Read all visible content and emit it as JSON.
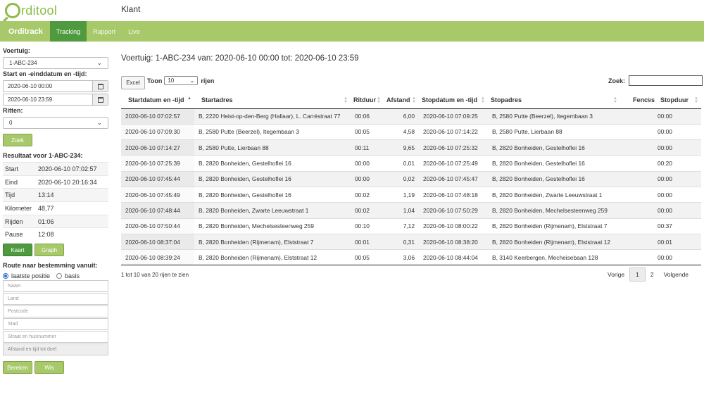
{
  "app": {
    "logo_text": "rditool",
    "page_heading": "Klant"
  },
  "nav": {
    "brand": "Orditrack",
    "items": [
      "Tracking",
      "Rapport",
      "Live"
    ],
    "active": "Tracking"
  },
  "sidebar": {
    "vehicle_label": "Voertuig:",
    "vehicle_value": "1-ABC-234",
    "date_label": "Start en -einddatum en -tijd:",
    "start_value": "2020-06-10 00:00",
    "end_value": "2020-06-10 23:59",
    "trips_label": "Ritten:",
    "trips_value": "0",
    "search_button": "Zoek",
    "result_label": "Resultaat voor 1-ABC-234:",
    "results": [
      {
        "key": "Start",
        "value": "2020-06-10 07:02:57"
      },
      {
        "key": "Eind",
        "value": "2020-06-10 20:16:34"
      },
      {
        "key": "Tijd",
        "value": "13:14"
      },
      {
        "key": "Kilometer",
        "value": "48,77"
      },
      {
        "key": "Rijden",
        "value": "01:06"
      },
      {
        "key": "Pause",
        "value": "12:08"
      }
    ],
    "map_button": "Kaart",
    "graph_button": "Graph",
    "route_label": "Route naar bestemming vanuit:",
    "radio_last": "laatste positie",
    "radio_base": "basis",
    "placeholders": {
      "name": "Naam",
      "country": "Land",
      "postcode": "Postcode",
      "city": "Stad",
      "street": "Straat en huisnummer",
      "distance": "Afstand en tijd tot doel"
    },
    "calc_button": "Bereken",
    "clear_button": "Wis"
  },
  "main": {
    "title": "Voertuig: 1-ABC-234 van: 2020-06-10 00:00 tot: 2020-06-10 23:59",
    "excel_button": "Excel",
    "show_label": "Toon",
    "page_length": "10",
    "rows_label": "rijen",
    "search_label": "Zoek:",
    "columns": [
      "Startdatum en -tijd",
      "Startadres",
      "Ritduur",
      "Afstand",
      "Stopdatum en -tijd",
      "Stopadres",
      "Fences",
      "Stopduur"
    ],
    "rows": [
      [
        "2020-06-10 07:02:57",
        "B, 2220 Heist-op-den-Berg (Hallaar), L. Carréstraat 77",
        "00:06",
        "6,00",
        "2020-06-10 07:09:25",
        "B, 2580 Putte (Beerzel), Itegembaan 3",
        "",
        "00:00"
      ],
      [
        "2020-06-10 07:09:30",
        "B, 2580 Putte (Beerzel), Itegembaan 3",
        "00:05",
        "4,58",
        "2020-06-10 07:14:22",
        "B, 2580 Putte, Lierbaan 88",
        "",
        "00:00"
      ],
      [
        "2020-06-10 07:14:27",
        "B, 2580 Putte, Lierbaan 88",
        "00:11",
        "9,65",
        "2020-06-10 07:25:32",
        "B, 2820 Bonheiden, Gestelhoflei 16",
        "",
        "00:00"
      ],
      [
        "2020-06-10 07:25:39",
        "B, 2820 Bonheiden, Gestelhoflei 16",
        "00:00",
        "0,01",
        "2020-06-10 07:25:49",
        "B, 2820 Bonheiden, Gestelhoflei 16",
        "",
        "00:20"
      ],
      [
        "2020-06-10 07:45:44",
        "B, 2820 Bonheiden, Gestelhoflei 16",
        "00:00",
        "0,02",
        "2020-06-10 07:45:47",
        "B, 2820 Bonheiden, Gestelhoflei 16",
        "",
        "00:00"
      ],
      [
        "2020-06-10 07:45:49",
        "B, 2820 Bonheiden, Gestelhoflei 16",
        "00:02",
        "1,19",
        "2020-06-10 07:48:18",
        "B, 2820 Bonheiden, Zwarte Leeuwstraat 1",
        "",
        "00:00"
      ],
      [
        "2020-06-10 07:48:44",
        "B, 2820 Bonheiden, Zwarte Leeuwstraat 1",
        "00:02",
        "1,04",
        "2020-06-10 07:50:29",
        "B, 2820 Bonheiden, Mechelsesteenweg 259",
        "",
        "00:00"
      ],
      [
        "2020-06-10 07:50:44",
        "B, 2820 Bonheiden, Mechelsesteenweg 259",
        "00:10",
        "7,12",
        "2020-06-10 08:00:22",
        "B, 2820 Bonheiden (Rijmenam), Elststraat 7",
        "",
        "00:37"
      ],
      [
        "2020-06-10 08:37:04",
        "B, 2820 Bonheiden (Rijmenam), Elststraat 7",
        "00:01",
        "0,31",
        "2020-06-10 08:38:20",
        "B, 2820 Bonheiden (Rijmenam), Elststraat 12",
        "",
        "00:01"
      ],
      [
        "2020-06-10 08:39:24",
        "B, 2820 Bonheiden (Rijmenam), Elststraat 12",
        "00:05",
        "3,06",
        "2020-06-10 08:44:04",
        "B, 3140 Keerbergen, Mecheisebaan 128",
        "",
        "00:00"
      ]
    ],
    "info": "1 tot 10 van 20 rijen te zien",
    "pager": {
      "prev": "Vorige",
      "pages": [
        "1",
        "2"
      ],
      "current": "1",
      "next": "Volgende"
    }
  },
  "colors": {
    "nav_bg": "#a8c96a",
    "nav_active": "#4f9a3f",
    "logo": "#8cbc4a"
  }
}
